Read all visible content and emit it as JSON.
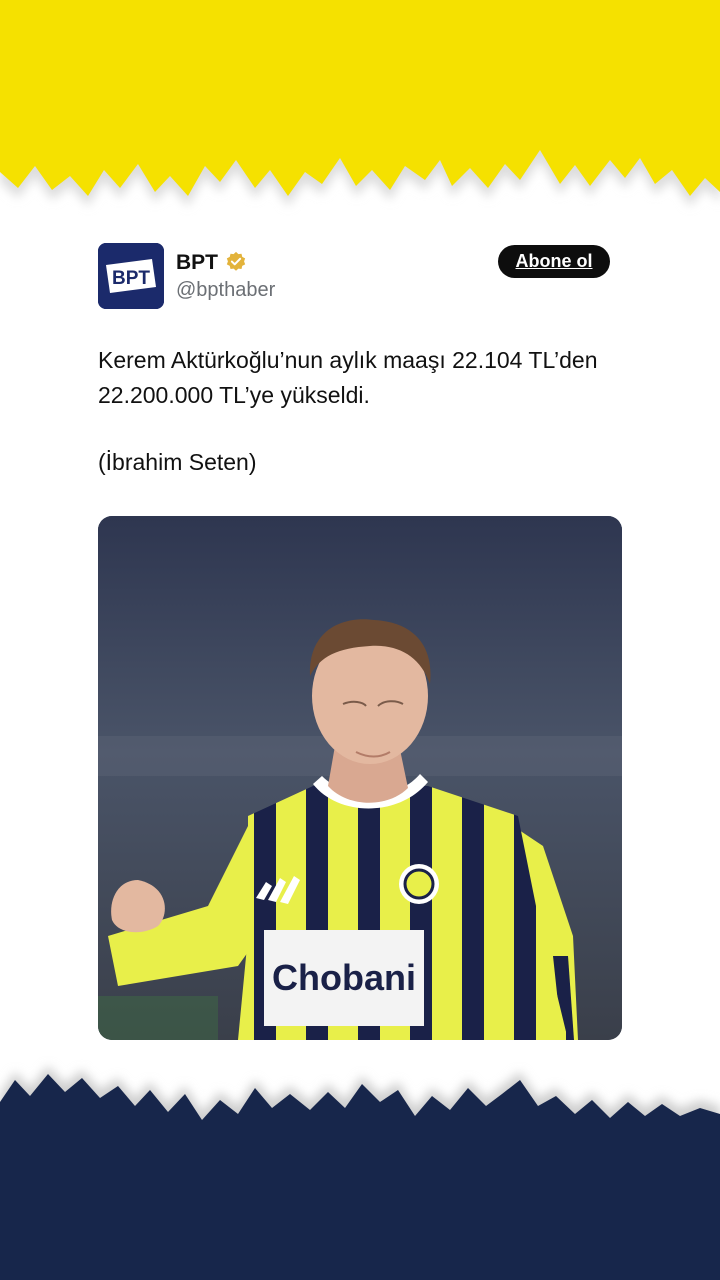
{
  "colors": {
    "top_band": "#f5e100",
    "bottom_band": "#17264b",
    "card_bg": "#ffffff",
    "follow_button_bg": "#0d0d0d",
    "handle_text": "#6b6f74",
    "verified_badge": "#e3b33b"
  },
  "account": {
    "name": "BPT",
    "handle": "@bpthaber",
    "verified": true,
    "avatar_logo_text": "BPT",
    "avatar_icon": "bpt-logo-icon",
    "verified_icon": "verified-badge-icon"
  },
  "follow_button": {
    "label": "Abone ol"
  },
  "post": {
    "text": "Kerem Aktürkoğlu’nun aylık maaşı 22.104 TL’den 22.200.000 TL’ye yükseldi.",
    "credit": "(İbrahim Seten)"
  },
  "photo": {
    "jersey_sponsor": "Chobani"
  }
}
